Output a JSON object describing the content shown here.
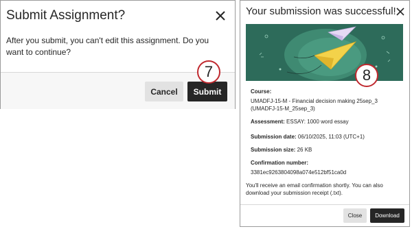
{
  "submit_dialog": {
    "title": "Submit Assignment?",
    "message": "After you submit, you can't edit this assignment. Do you want to continue?",
    "cancel_label": "Cancel",
    "submit_label": "Submit",
    "callout_number": "7"
  },
  "success_dialog": {
    "title": "Your submission was successful!",
    "callout_number": "8",
    "course_label": "Course:",
    "course_value": "UMADFJ-15-M - Financial decision making 25sep_3 (UMADFJ-15-M_25sep_3)",
    "assessment_label": "Assessment:",
    "assessment_value": "ESSAY: 1000 word essay",
    "submission_date_label": "Submission date:",
    "submission_date_value": "06/10/2025, 11:03 (UTC+1)",
    "submission_size_label": "Submission size:",
    "submission_size_value": "26 KB",
    "confirmation_label": "Confirmation number:",
    "confirmation_value": "3381ec9263804098a074e512bf51ca0d",
    "note": "You'll receive an email confirmation shortly. You can also download your submission receipt (.txt).",
    "close_label": "Close",
    "download_label": "Download"
  },
  "colors": {
    "primary_button": "#262626",
    "secondary_button": "#e2e2e2",
    "banner_background": "#2d6b5a",
    "callout_border": "#c0282e"
  },
  "icons": {
    "close": "close-icon",
    "banner": "paper-planes-illustration"
  }
}
